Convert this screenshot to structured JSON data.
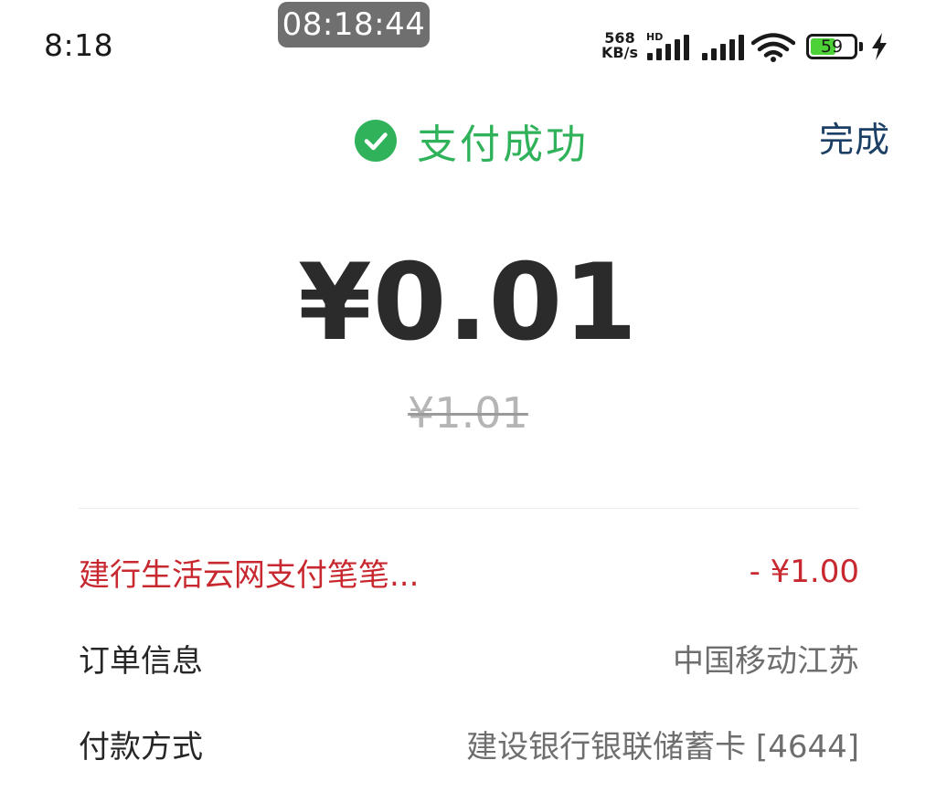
{
  "status_bar": {
    "time": "8:18",
    "time_chip": "08:18:44",
    "net_speed_value": "568",
    "net_speed_unit": "KB/s",
    "network_label": "HD",
    "battery_level": "59",
    "battery_percent": 59
  },
  "header": {
    "title": "支付成功",
    "done_label": "完成"
  },
  "payment": {
    "amount": "¥0.01",
    "original_amount": "¥1.01"
  },
  "details": {
    "discount": {
      "label": "建行生活云网支付笔笔...",
      "value": "- ¥1.00"
    },
    "order": {
      "label": "订单信息",
      "value": "中国移动江苏"
    },
    "payment_method": {
      "label": "付款方式",
      "value": "建设银行银联储蓄卡 [4644]"
    }
  },
  "colors": {
    "success_green": "#2fb25a",
    "discount_red": "#c8282f",
    "link_blue": "#1c3f66"
  },
  "icons": [
    "check-circle-icon",
    "signal-icon",
    "wifi-icon",
    "battery-icon",
    "charging-bolt-icon"
  ]
}
